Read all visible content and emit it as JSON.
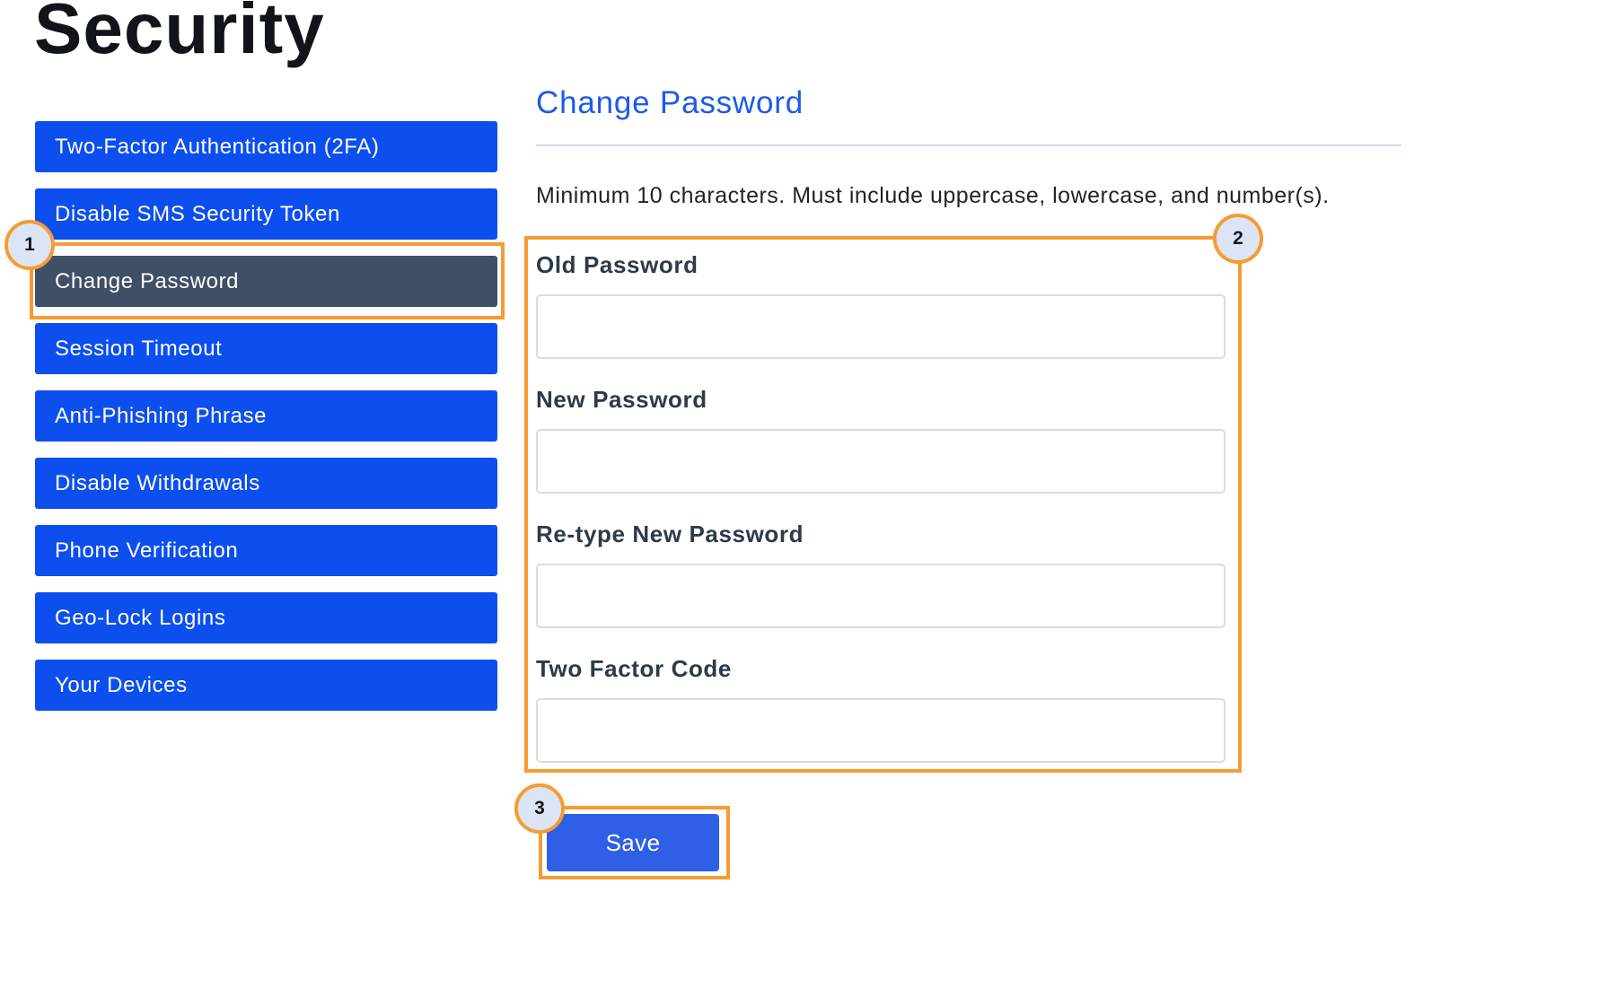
{
  "page": {
    "title": "Security"
  },
  "sidebar": {
    "items": [
      {
        "label": "Two-Factor Authentication (2FA)",
        "active": false
      },
      {
        "label": "Disable SMS Security Token",
        "active": false
      },
      {
        "label": "Change Password",
        "active": true
      },
      {
        "label": "Session Timeout",
        "active": false
      },
      {
        "label": "Anti-Phishing Phrase",
        "active": false
      },
      {
        "label": "Disable Withdrawals",
        "active": false
      },
      {
        "label": "Phone Verification",
        "active": false
      },
      {
        "label": "Geo-Lock Logins",
        "active": false
      },
      {
        "label": "Your Devices",
        "active": false
      }
    ]
  },
  "main": {
    "section_title": "Change Password",
    "hint": "Minimum 10 characters. Must include uppercase, lowercase, and number(s).",
    "fields": [
      {
        "label": "Old Password",
        "value": ""
      },
      {
        "label": "New Password",
        "value": ""
      },
      {
        "label": "Re-type New Password",
        "value": ""
      },
      {
        "label": "Two Factor Code",
        "value": ""
      }
    ],
    "save_label": "Save"
  },
  "callouts": [
    "1",
    "2",
    "3"
  ],
  "colors": {
    "sidebar_item": "#0c4fee",
    "sidebar_item_active": "#3e4f66",
    "section_title": "#1d5be8",
    "save_button": "#2f5fe6",
    "callout_outline": "#f59c32",
    "callout_badge_fill": "#dbe5f6"
  }
}
